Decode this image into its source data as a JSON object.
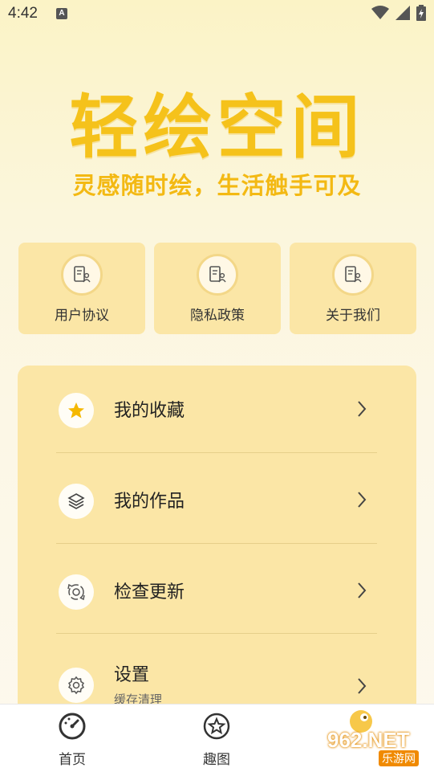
{
  "status_bar": {
    "time": "4:42",
    "notification_letter": "A"
  },
  "hero": {
    "title": "轻绘空间",
    "subtitle": "灵感随时绘，生活触手可及"
  },
  "quick_links": [
    {
      "label": "用户协议",
      "icon": "document-user-icon"
    },
    {
      "label": "隐私政策",
      "icon": "document-user-icon"
    },
    {
      "label": "关于我们",
      "icon": "document-user-icon"
    }
  ],
  "menu": [
    {
      "label": "我的收藏",
      "icon": "star-icon"
    },
    {
      "label": "我的作品",
      "icon": "layers-icon"
    },
    {
      "label": "检查更新",
      "icon": "refresh-icon"
    },
    {
      "label": "设置",
      "sublabel": "缓存清理",
      "icon": "gear-icon"
    }
  ],
  "tabbar": [
    {
      "label": "首页",
      "icon": "speedometer-icon"
    },
    {
      "label": "趣图",
      "icon": "star-circle-icon"
    }
  ],
  "watermark": {
    "text": "962.NET",
    "subtext": "乐游网"
  },
  "colors": {
    "accent": "#f5c21b",
    "panel": "#fbe6a6",
    "background": "#fbf5dc"
  }
}
